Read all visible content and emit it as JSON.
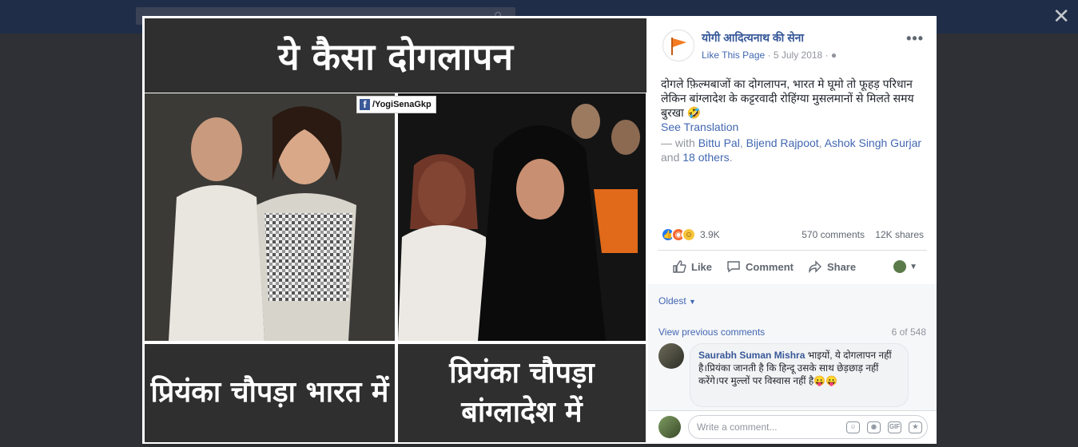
{
  "background": {
    "search_placeholder": "Search"
  },
  "photo": {
    "title": "ये कैसा दोगलापन",
    "watermark": "/YogiSenaGkp",
    "caption_left": "प्रियंका चौपड़ा भारत में",
    "caption_right": "प्रियंका चौपड़ा बांग्लादेश में"
  },
  "post": {
    "page_name": "योगी आदित्यनाथ की सेना",
    "like_page": "Like This Page",
    "date": "5 July 2018",
    "text": "दोगले फ़िल्मबाजों का दोगलापन, भारत मे घूमो तो फूहड़ परिधान लेकिन बांग्लादेश के कट्टरवादी रोहिंग्या मुसलमानों से मिलते समय बुरखा 🤣",
    "see_translation": "See Translation",
    "with_prefix": "— with",
    "tag1": "Bittu Pal",
    "tag2": "Bijend Rajpoot",
    "tag3": "Ashok Singh Gurjar",
    "and_text": "and",
    "others": "18 others",
    "reactions_count": "3.9K",
    "comments_count": "570 comments",
    "shares_count": "12K shares"
  },
  "actions": {
    "like": "Like",
    "comment": "Comment",
    "share": "Share"
  },
  "comments": {
    "sort_label": "Oldest",
    "view_previous": "View previous comments",
    "count_of": "6 of 548",
    "author": "Saurabh Suman Mishra",
    "text": "भाइयों, ये दोगलापन नहीं है।प्रियंका जानती है कि हिन्दू उसके साथ छेड़छाड़ नहीं करेंगे।पर मुल्लों पर विस्वास नहीं है😛😛",
    "write_placeholder": "Write a comment..."
  },
  "colors": {
    "link": "#4267b2",
    "page_name": "#365899",
    "like_reaction": "#2078f4"
  }
}
